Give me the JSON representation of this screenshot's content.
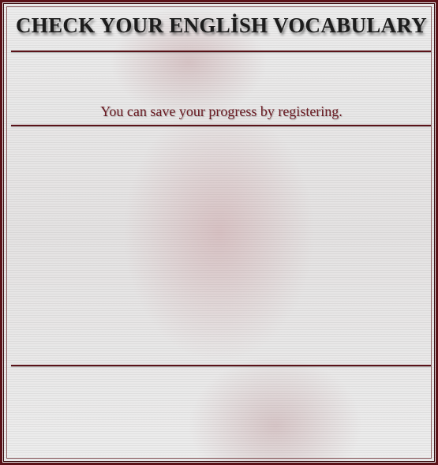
{
  "header": {
    "title": "CHECK YOUR ENGLİSH VOCABULARY"
  },
  "notice": {
    "text": "You can save your progress by registering."
  },
  "colors": {
    "accent": "#5a1218",
    "notice_text": "#6a1a22",
    "title_text": "#1c1c1c",
    "background": "#e8e6e6"
  }
}
